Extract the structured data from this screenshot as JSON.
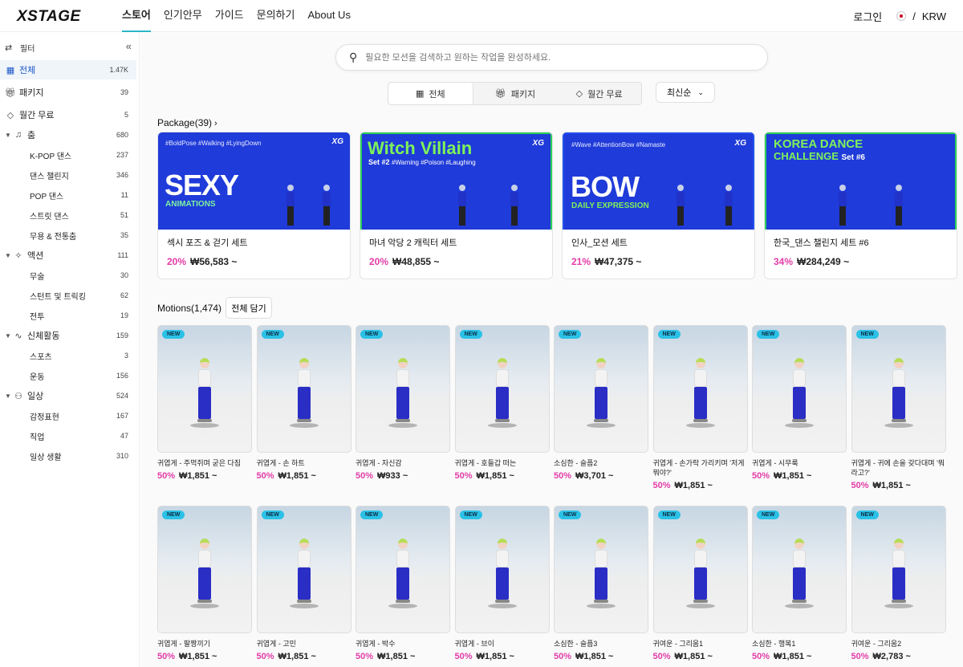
{
  "header": {
    "logo": "XSTAGE",
    "nav": [
      "스토어",
      "인기안무",
      "가이드",
      "문의하기",
      "About Us"
    ],
    "login": "로그인",
    "separator": "/",
    "currency": "KRW"
  },
  "sidebar": {
    "filter_label": "필터",
    "collapse_glyph": "«",
    "top_items": [
      {
        "label": "전체",
        "count": "1.47K"
      },
      {
        "label": "패키지",
        "count": "39"
      },
      {
        "label": "월간 무료",
        "count": "5"
      }
    ],
    "categories": [
      {
        "label": "춤",
        "count": "680",
        "sub": [
          {
            "label": "K-POP 댄스",
            "count": "237"
          },
          {
            "label": "댄스 챌린지",
            "count": "346"
          },
          {
            "label": "POP 댄스",
            "count": "11"
          },
          {
            "label": "스트릿 댄스",
            "count": "51"
          },
          {
            "label": "무용 & 전통춤",
            "count": "35"
          }
        ]
      },
      {
        "label": "액션",
        "count": "111",
        "sub": [
          {
            "label": "무술",
            "count": "30"
          },
          {
            "label": "스턴트 및 트릭킹",
            "count": "62"
          },
          {
            "label": "전투",
            "count": "19"
          }
        ]
      },
      {
        "label": "신체활동",
        "count": "159",
        "sub": [
          {
            "label": "스포츠",
            "count": "3"
          },
          {
            "label": "운동",
            "count": "156"
          }
        ]
      },
      {
        "label": "일상",
        "count": "524",
        "sub": [
          {
            "label": "감정표현",
            "count": "167"
          },
          {
            "label": "직업",
            "count": "47"
          },
          {
            "label": "일상 생활",
            "count": "310"
          }
        ]
      }
    ]
  },
  "search": {
    "placeholder": "필요한 모션을 검색하고 원하는 작업을 완성하세요."
  },
  "tabs": [
    "전체",
    "패키지",
    "월간 무료"
  ],
  "sort": {
    "label": "최신순"
  },
  "packages": {
    "title": "Package(39)",
    "items": [
      {
        "tags": "#BoldPose #Walking #LyingDown",
        "big": "SEXY",
        "sub": "ANIMATIONS",
        "name": "섹시 포즈 & 걷기 세트",
        "discount": "20%",
        "price": "₩56,583 ~"
      },
      {
        "tags": "#Warning #Poison #Laughing",
        "head": "Witch Villain",
        "setno": "Set #2",
        "name": "마녀 악당 2 캐릭터 세트",
        "discount": "20%",
        "price": "₩48,855 ~"
      },
      {
        "tags": "#Wave #AttentionBow #Namaste",
        "big": "BOW",
        "sub": "DAILY EXPRESSION",
        "name": "인사_모션 세트",
        "discount": "21%",
        "price": "₩47,375 ~"
      },
      {
        "head": "KOREA DANCE",
        "head2": "CHALLENGE",
        "setno": "Set #6",
        "name": "한국_댄스 챌린지 세트 #6",
        "discount": "34%",
        "price": "₩284,249 ~"
      }
    ],
    "xg_mark": "XG"
  },
  "motions": {
    "title": "Motions(1,474)",
    "cart_button": "전체 담기",
    "badge": "NEW",
    "row1": [
      {
        "name": "귀엽게 - 주먹쥐며 굳은 다짐",
        "discount": "50%",
        "price": "₩1,851 ~"
      },
      {
        "name": "귀엽게 - 손 하트",
        "discount": "50%",
        "price": "₩1,851 ~"
      },
      {
        "name": "귀엽게 - 자신감",
        "discount": "50%",
        "price": "₩933 ~"
      },
      {
        "name": "귀엽게 - 호들갑 떠는",
        "discount": "50%",
        "price": "₩1,851 ~"
      },
      {
        "name": "소심한 - 슬픔2",
        "discount": "50%",
        "price": "₩3,701 ~"
      },
      {
        "name": "귀엽게 - 손가락 가리키며 '저게 뭐야?'",
        "discount": "50%",
        "price": "₩1,851 ~"
      },
      {
        "name": "귀엽게 - 시무룩",
        "discount": "50%",
        "price": "₩1,851 ~"
      },
      {
        "name": "귀엽게 - 귀에 손을 갖다대며 '뭐라고?'",
        "discount": "50%",
        "price": "₩1,851 ~"
      }
    ],
    "row2": [
      {
        "name": "귀엽게 - 팔짱끼기",
        "discount": "50%",
        "price": "₩1,851 ~"
      },
      {
        "name": "귀엽게 - 고민",
        "discount": "50%",
        "price": "₩1,851 ~"
      },
      {
        "name": "귀엽게 - 박수",
        "discount": "50%",
        "price": "₩1,851 ~"
      },
      {
        "name": "귀엽게 - 브이",
        "discount": "50%",
        "price": "₩1,851 ~"
      },
      {
        "name": "소심한 - 슬픔3",
        "discount": "50%",
        "price": "₩1,851 ~"
      },
      {
        "name": "귀여운 - 그리움1",
        "discount": "50%",
        "price": "₩1,851 ~"
      },
      {
        "name": "소심한 - 행복1",
        "discount": "50%",
        "price": "₩1,851 ~"
      },
      {
        "name": "귀여운 - 그리움2",
        "discount": "50%",
        "price": "₩2,783 ~"
      }
    ]
  },
  "colors": {
    "accent": "#2bb5c9",
    "discount": "#e23ca7",
    "active_blue": "#1a55c9",
    "badge": "#2bc1e6"
  }
}
